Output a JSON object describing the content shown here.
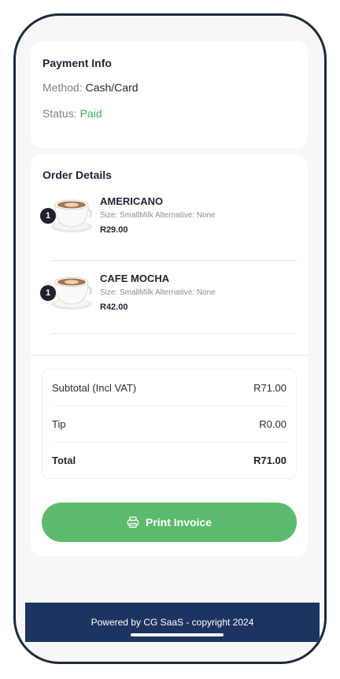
{
  "payment": {
    "title": "Payment Info",
    "method_label": "Method:",
    "method_value": "Cash/Card",
    "status_label": "Status:",
    "status_value": "Paid",
    "status_color": "#3bb05c"
  },
  "order": {
    "title": "Order Details",
    "items": [
      {
        "qty": "1",
        "name": "AMERICANO",
        "meta": "Size: SmallMilk Alternative: None",
        "price": "R29.00",
        "icon": "coffee-cup-icon"
      },
      {
        "qty": "1",
        "name": "CAFE MOCHA",
        "meta": "Size: SmallMilk Alternative: None",
        "price": "R42.00",
        "icon": "coffee-cup-icon"
      }
    ]
  },
  "totals": {
    "subtotal_label": "Subtotal (Incl VAT)",
    "subtotal_value": "R71.00",
    "tip_label": "Tip",
    "tip_value": "R0.00",
    "total_label": "Total",
    "total_value": "R71.00"
  },
  "actions": {
    "print_label": "Print Invoice",
    "print_icon": "printer-icon",
    "button_color": "#5cba6c"
  },
  "footer": {
    "text": "Powered by CG SaaS - copyright 2024",
    "color": "#1d3461"
  }
}
